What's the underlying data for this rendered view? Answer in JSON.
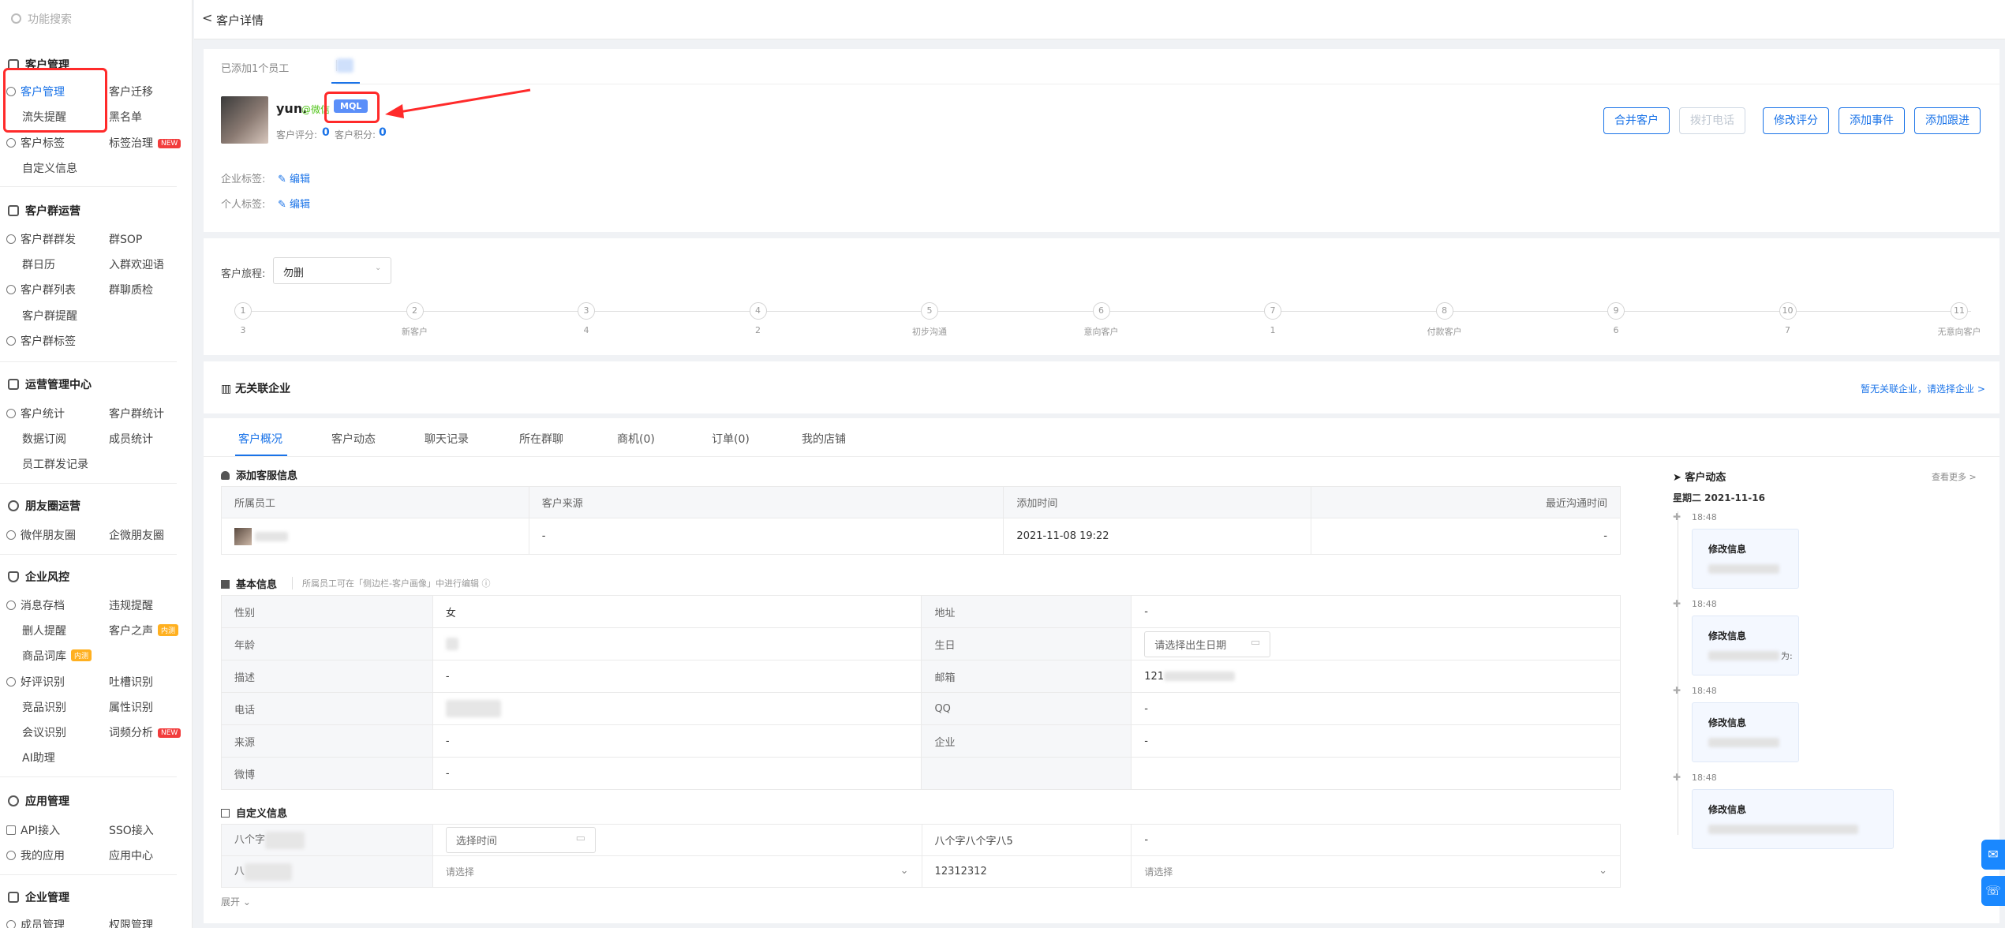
{
  "sidebar": {
    "search_placeholder": "功能搜索",
    "sections": [
      {
        "title": "客户管理",
        "items": [
          "客户管理",
          "客户迁移",
          "流失提醒",
          "黑名单",
          "客户标签",
          "标签治理",
          "自定义信息"
        ]
      },
      {
        "title": "客户群运营",
        "items": [
          "客户群群发",
          "群SOP",
          "群日历",
          "入群欢迎语",
          "客户群列表",
          "群聊质检",
          "客户群提醒",
          "客户群标签"
        ]
      },
      {
        "title": "运营管理中心",
        "items": [
          "客户统计",
          "客户群统计",
          "数据订阅",
          "成员统计",
          "员工群发记录"
        ]
      },
      {
        "title": "朋友圈运营",
        "items": [
          "微伴朋友圈",
          "企微朋友圈"
        ]
      },
      {
        "title": "企业风控",
        "items": [
          "消息存档",
          "违规提醒",
          "删人提醒",
          "客户之声",
          "商品词库",
          "好评识别",
          "吐槽识别",
          "竞品识别",
          "属性识别",
          "会议识别",
          "词频分析",
          "AI助理"
        ]
      },
      {
        "title": "应用管理",
        "items": [
          "API接入",
          "SSO接入",
          "我的应用",
          "应用中心"
        ]
      },
      {
        "title": "企业管理",
        "items": [
          "成员管理",
          "权限管理"
        ]
      }
    ],
    "badges": {
      "new": "NEW",
      "hot": "内测"
    }
  },
  "topbar": {
    "back": "<",
    "title": "客户详情"
  },
  "customer": {
    "staff_added": "已添加1个员工",
    "name": "yun.",
    "wechat": "@微信",
    "tag_mql": "MQL",
    "score_label": "客户评分:",
    "score_value": "0",
    "points_label": "客户积分:",
    "points_value": "0",
    "corp_tag_label": "企业标签:",
    "personal_tag_label": "个人标签:",
    "edit_label": "编辑"
  },
  "actions": [
    "合并客户",
    "拨打电话",
    "修改评分",
    "添加事件",
    "添加跟进"
  ],
  "journey": {
    "label": "客户旅程:",
    "select_value": "勿删",
    "stages": [
      {
        "n": "1",
        "label": "3"
      },
      {
        "n": "2",
        "label": "新客户"
      },
      {
        "n": "3",
        "label": "4"
      },
      {
        "n": "4",
        "label": "2"
      },
      {
        "n": "5",
        "label": "初步沟通"
      },
      {
        "n": "6",
        "label": "意向客户"
      },
      {
        "n": "7",
        "label": "1"
      },
      {
        "n": "8",
        "label": "付款客户"
      },
      {
        "n": "9",
        "label": "6"
      },
      {
        "n": "10",
        "label": "7"
      },
      {
        "n": "11",
        "label": "无意向客户"
      }
    ]
  },
  "company": {
    "title": "无关联企业",
    "link": "暂无关联企业，请选择企业 >"
  },
  "tabs": [
    "客户概况",
    "客户动态",
    "聊天记录",
    "所在群聊",
    "商机(0)",
    "订单(0)",
    "我的店铺"
  ],
  "service_info": {
    "title": "添加客服信息",
    "headers": [
      "所属员工",
      "客户来源",
      "添加时间",
      "最近沟通时间"
    ],
    "row": [
      "",
      "-",
      "2021-11-08 19:22",
      "-"
    ]
  },
  "basic_info": {
    "title": "基本信息",
    "hint": "所属员工可在「侧边栏-客户画像」中进行编辑 ⓘ",
    "rows": [
      [
        "性别",
        "女",
        "地址",
        "-"
      ],
      [
        "年龄",
        "",
        "生日",
        "请选择出生日期"
      ],
      [
        "描述",
        "-",
        "邮箱",
        "121"
      ],
      [
        "电话",
        "",
        "QQ",
        "-"
      ],
      [
        "来源",
        "-",
        "企业",
        "-"
      ],
      [
        "微博",
        "-",
        "",
        ""
      ]
    ]
  },
  "custom_info": {
    "title": "自定义信息",
    "rows": [
      [
        "八个字",
        "选择时间",
        "八个字八个字八5",
        "-"
      ],
      [
        "八",
        "请选择",
        "12312312",
        "请选择"
      ]
    ],
    "expand": "展开"
  },
  "activity": {
    "title": "客户动态",
    "more": "查看更多 >",
    "date": "星期二 2021-11-16",
    "items": [
      {
        "time": "18:48",
        "title": "修改信息",
        "tail": ""
      },
      {
        "time": "18:48",
        "title": "修改信息",
        "tail": "为:"
      },
      {
        "time": "18:48",
        "title": "修改信息",
        "tail": ""
      },
      {
        "time": "18:48",
        "title": "修改信息",
        "tail": ""
      }
    ]
  },
  "colors": {
    "accent": "#1a73e8",
    "highlight": "#ff2a2a",
    "tag_bg": "#5b8ff9"
  }
}
